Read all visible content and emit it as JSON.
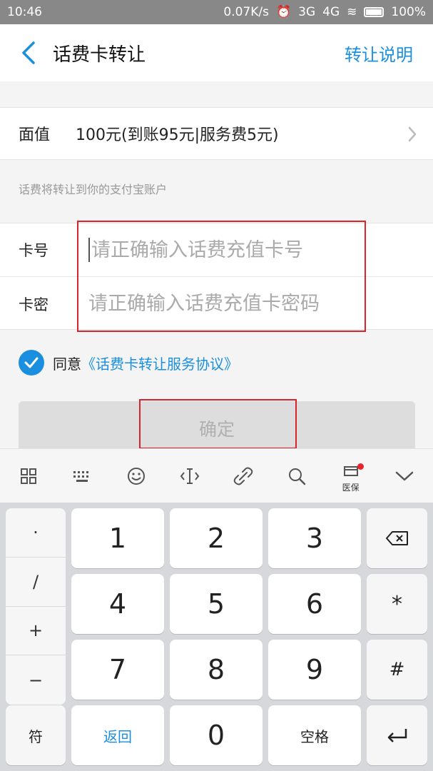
{
  "status_bar": {
    "time": "10:46",
    "network_speed": "0.07K/s",
    "signal1": "3G",
    "signal2": "4G",
    "battery": "100%"
  },
  "nav": {
    "title": "话费卡转让",
    "right_link": "转让说明"
  },
  "face_value": {
    "label": "面值",
    "value": "100元(到账95元|服务费5元)"
  },
  "hint": "话费将转让到你的支付宝账户",
  "card_number": {
    "label": "卡号",
    "placeholder": "请正确输入话费充值卡号"
  },
  "card_password": {
    "label": "卡密",
    "placeholder": "请正确输入话费充值卡密码"
  },
  "agreement": {
    "prefix": "同意",
    "link": "《话费卡转让服务协议》"
  },
  "confirm_button": "确定",
  "keyboard_toolbar": {
    "icons": [
      "grid-icon",
      "keyboard-icon",
      "emoji-icon",
      "cursor-icon",
      "clip-icon",
      "search-icon",
      "medical-card-icon",
      "chevron-down-icon"
    ],
    "medical_label": "医保"
  },
  "keyboard": {
    "side_keys": [
      "·",
      "/",
      "+",
      "−"
    ],
    "digits": [
      "1",
      "2",
      "3",
      "4",
      "5",
      "6",
      "7",
      "8",
      "9",
      "0"
    ],
    "asterisk": "*",
    "hash": "#",
    "symbol_key": "符",
    "back_key": "返回",
    "space_key": "空格"
  }
}
